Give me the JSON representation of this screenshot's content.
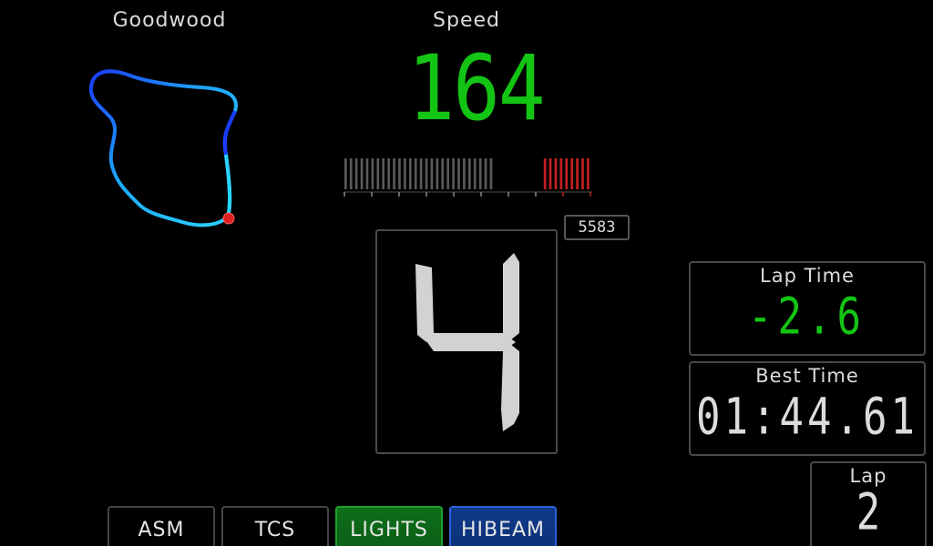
{
  "track": {
    "name": "Goodwood",
    "map_icon": "track-map",
    "marker_color": "#e02020"
  },
  "speed": {
    "label": "Speed",
    "value": "164",
    "color": "#14c414"
  },
  "rpm": {
    "readout": "5583",
    "bar_segments_total": 46,
    "bar_segments_lit": 28,
    "redline_segments": 9,
    "colors": {
      "normal": "#5a5a5a",
      "redline": "#c42020"
    }
  },
  "gear": {
    "value": "4"
  },
  "lap_time": {
    "title": "Lap Time",
    "value": "-2.6",
    "color": "#14c414"
  },
  "best_time": {
    "title": "Best Time",
    "value": "01:44.61"
  },
  "lap": {
    "title": "Lap",
    "value": "2"
  },
  "indicators": [
    {
      "label": "ASM",
      "state": "off"
    },
    {
      "label": "TCS",
      "state": "off"
    },
    {
      "label": "LIGHTS",
      "state": "on",
      "color": "#0e6e1a"
    },
    {
      "label": "HIBEAM",
      "state": "on",
      "color": "#103a8a"
    }
  ]
}
